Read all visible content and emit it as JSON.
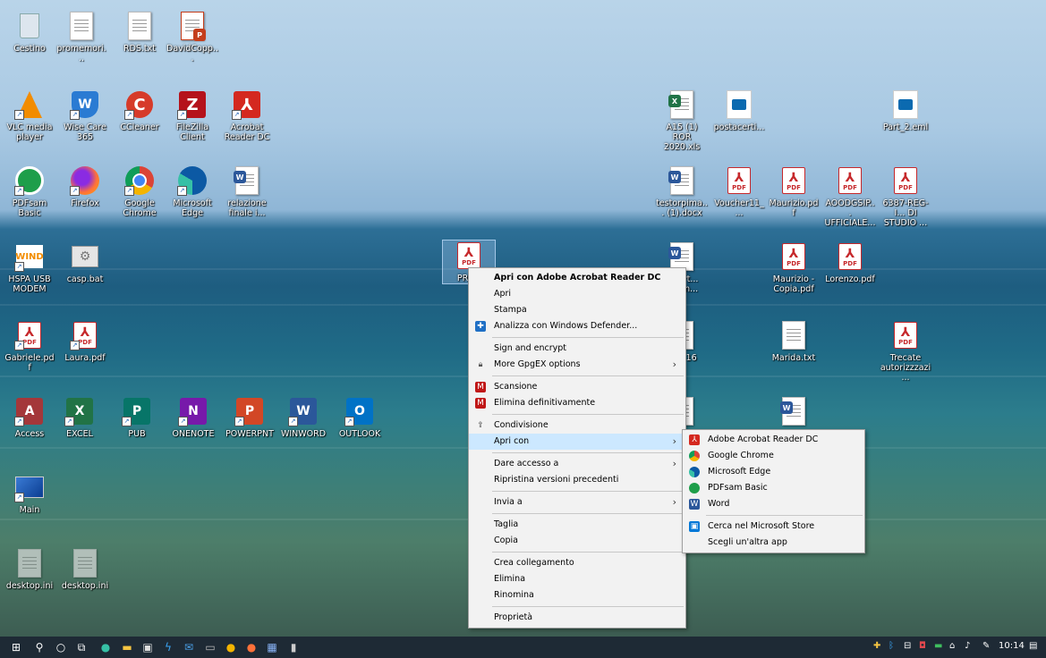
{
  "desktop": {
    "icons": [
      {
        "label": "Cestino"
      },
      {
        "label": "promemori..."
      },
      {
        "label": "RDS.txt"
      },
      {
        "label": "DavidCopp..."
      },
      {
        "label": "VLC media player"
      },
      {
        "label": "Wise Care 365"
      },
      {
        "label": "CCleaner"
      },
      {
        "label": "FileZilla Client"
      },
      {
        "label": "Acrobat Reader DC"
      },
      {
        "label": "PDFsam Basic"
      },
      {
        "label": "Firefox"
      },
      {
        "label": "Google Chrome"
      },
      {
        "label": "Microsoft Edge"
      },
      {
        "label": "relazione finale i..."
      },
      {
        "label": "HSPA USB MODEM"
      },
      {
        "label": "casp.bat"
      },
      {
        "label": "Gabriele.pdf"
      },
      {
        "label": "Laura.pdf"
      },
      {
        "label": "Access"
      },
      {
        "label": "EXCEL"
      },
      {
        "label": "PUB"
      },
      {
        "label": "ONENOTE"
      },
      {
        "label": "POWERPNT"
      },
      {
        "label": "WINWORD"
      },
      {
        "label": "OUTLOOK"
      },
      {
        "label": "Main"
      },
      {
        "label": "desktop.ini"
      },
      {
        "label": "desktop.ini"
      },
      {
        "label": "PROV"
      },
      {
        "label": "A15 (1) ROR 2020.xls"
      },
      {
        "label": "postacerti..."
      },
      {
        "label": "Part_2.eml"
      },
      {
        "label": "testorpima... (1).docx"
      },
      {
        "label": "Voucher11_..."
      },
      {
        "label": "Maurizio.pdf"
      },
      {
        "label": "AOODGSIP... UFFICIALE..."
      },
      {
        "label": "6387-REG-I... DI STUDIO ..."
      },
      {
        "label": "...cart... ...ltim..."
      },
      {
        "label": "Maurizio - Copia.pdf"
      },
      {
        "label": "Lorenzo.pdf"
      },
      {
        "label": "...0416"
      },
      {
        "label": "Marida.txt"
      },
      {
        "label": "Trecate autorizzzazi..."
      }
    ]
  },
  "context_menu": {
    "items": [
      {
        "label": "Apri con Adobe Acrobat Reader DC"
      },
      {
        "label": "Apri"
      },
      {
        "label": "Stampa"
      },
      {
        "label": "Analizza con Windows Defender..."
      },
      {
        "label": "Sign and encrypt"
      },
      {
        "label": "More GpgEX options"
      },
      {
        "label": "Scansione"
      },
      {
        "label": "Elimina definitivamente"
      },
      {
        "label": "Condivisione"
      },
      {
        "label": "Apri con"
      },
      {
        "label": "Dare accesso a"
      },
      {
        "label": "Ripristina versioni precedenti"
      },
      {
        "label": "Invia a"
      },
      {
        "label": "Taglia"
      },
      {
        "label": "Copia"
      },
      {
        "label": "Crea collegamento"
      },
      {
        "label": "Elimina"
      },
      {
        "label": "Rinomina"
      },
      {
        "label": "Proprietà"
      }
    ]
  },
  "open_with_submenu": {
    "items": [
      {
        "label": "Adobe Acrobat Reader DC"
      },
      {
        "label": "Google Chrome"
      },
      {
        "label": "Microsoft Edge"
      },
      {
        "label": "PDFsam Basic"
      },
      {
        "label": "Word"
      },
      {
        "label": "Cerca nel Microsoft Store"
      },
      {
        "label": "Scegli un'altra app"
      }
    ]
  },
  "taskbar": {
    "clock": "10:14"
  },
  "colors": {
    "taskbar": "#1e2a35",
    "menu_bg": "#f2f2f2",
    "menu_highlight": "#cce8ff",
    "pdf_red": "#c6282b"
  }
}
